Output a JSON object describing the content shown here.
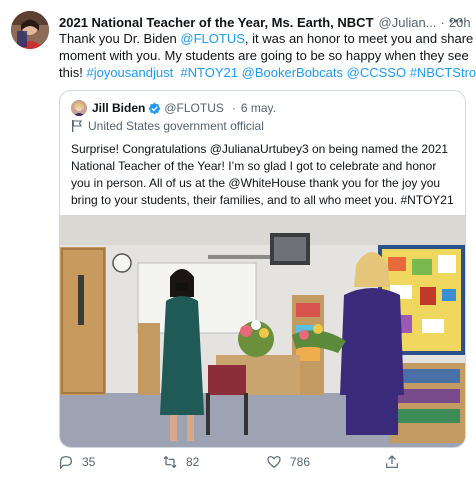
{
  "tweet": {
    "author_name": "2021 National Teacher of the Year, Ms. Earth, NBCT",
    "author_handle": "@Julian...",
    "separator": "·",
    "time": "20h",
    "more_icon": "more-horizontal-icon",
    "text_lines": [
      {
        "segments": [
          {
            "t": "Thank you Dr. Biden ",
            "link": false
          },
          {
            "t": "@FLOTUS",
            "link": true
          },
          {
            "t": ", it was an honor to meet you and share this",
            "link": false
          }
        ]
      },
      {
        "segments": [
          {
            "t": "moment with you. My students are going to be so happy when they see",
            "link": false
          }
        ]
      },
      {
        "segments": [
          {
            "t": "this! ",
            "link": false
          },
          {
            "t": "#joyousandjust",
            "link": true
          },
          {
            "t": "  ",
            "link": false
          },
          {
            "t": "#NTOY21",
            "link": true
          },
          {
            "t": " ",
            "link": false
          },
          {
            "t": "@BookerBobcats",
            "link": true
          },
          {
            "t": " ",
            "link": false
          },
          {
            "t": "@CCSSO",
            "link": true
          },
          {
            "t": " ",
            "link": false
          },
          {
            "t": "#NBCTStrong",
            "link": true
          }
        ]
      }
    ]
  },
  "quote": {
    "name": "Jill Biden",
    "handle": "@FLOTUS",
    "separator": "·",
    "date": "6 may.",
    "verified_icon": "verified-badge-icon",
    "label_icon": "government-flag-icon",
    "label": "United States government official",
    "text_lines": [
      "Surprise! Congratulations @JulianaUrtubey3 on being named the 2021",
      "National Teacher of the Year! I’m so glad I got to celebrate and honor",
      "you in person. All of us at the @WhiteHouse thank you for the joy you",
      "bring to your students, their families, and to all who meet you. #NTOY21"
    ]
  },
  "actions": {
    "reply_count": "35",
    "retweet_count": "82",
    "like_count": "786",
    "reply_icon": "reply-icon",
    "retweet_icon": "retweet-icon",
    "like_icon": "heart-icon",
    "share_icon": "share-icon"
  },
  "colors": {
    "link": "#1d9bf0",
    "secondary_text": "#536471",
    "border": "#cfd9de"
  }
}
